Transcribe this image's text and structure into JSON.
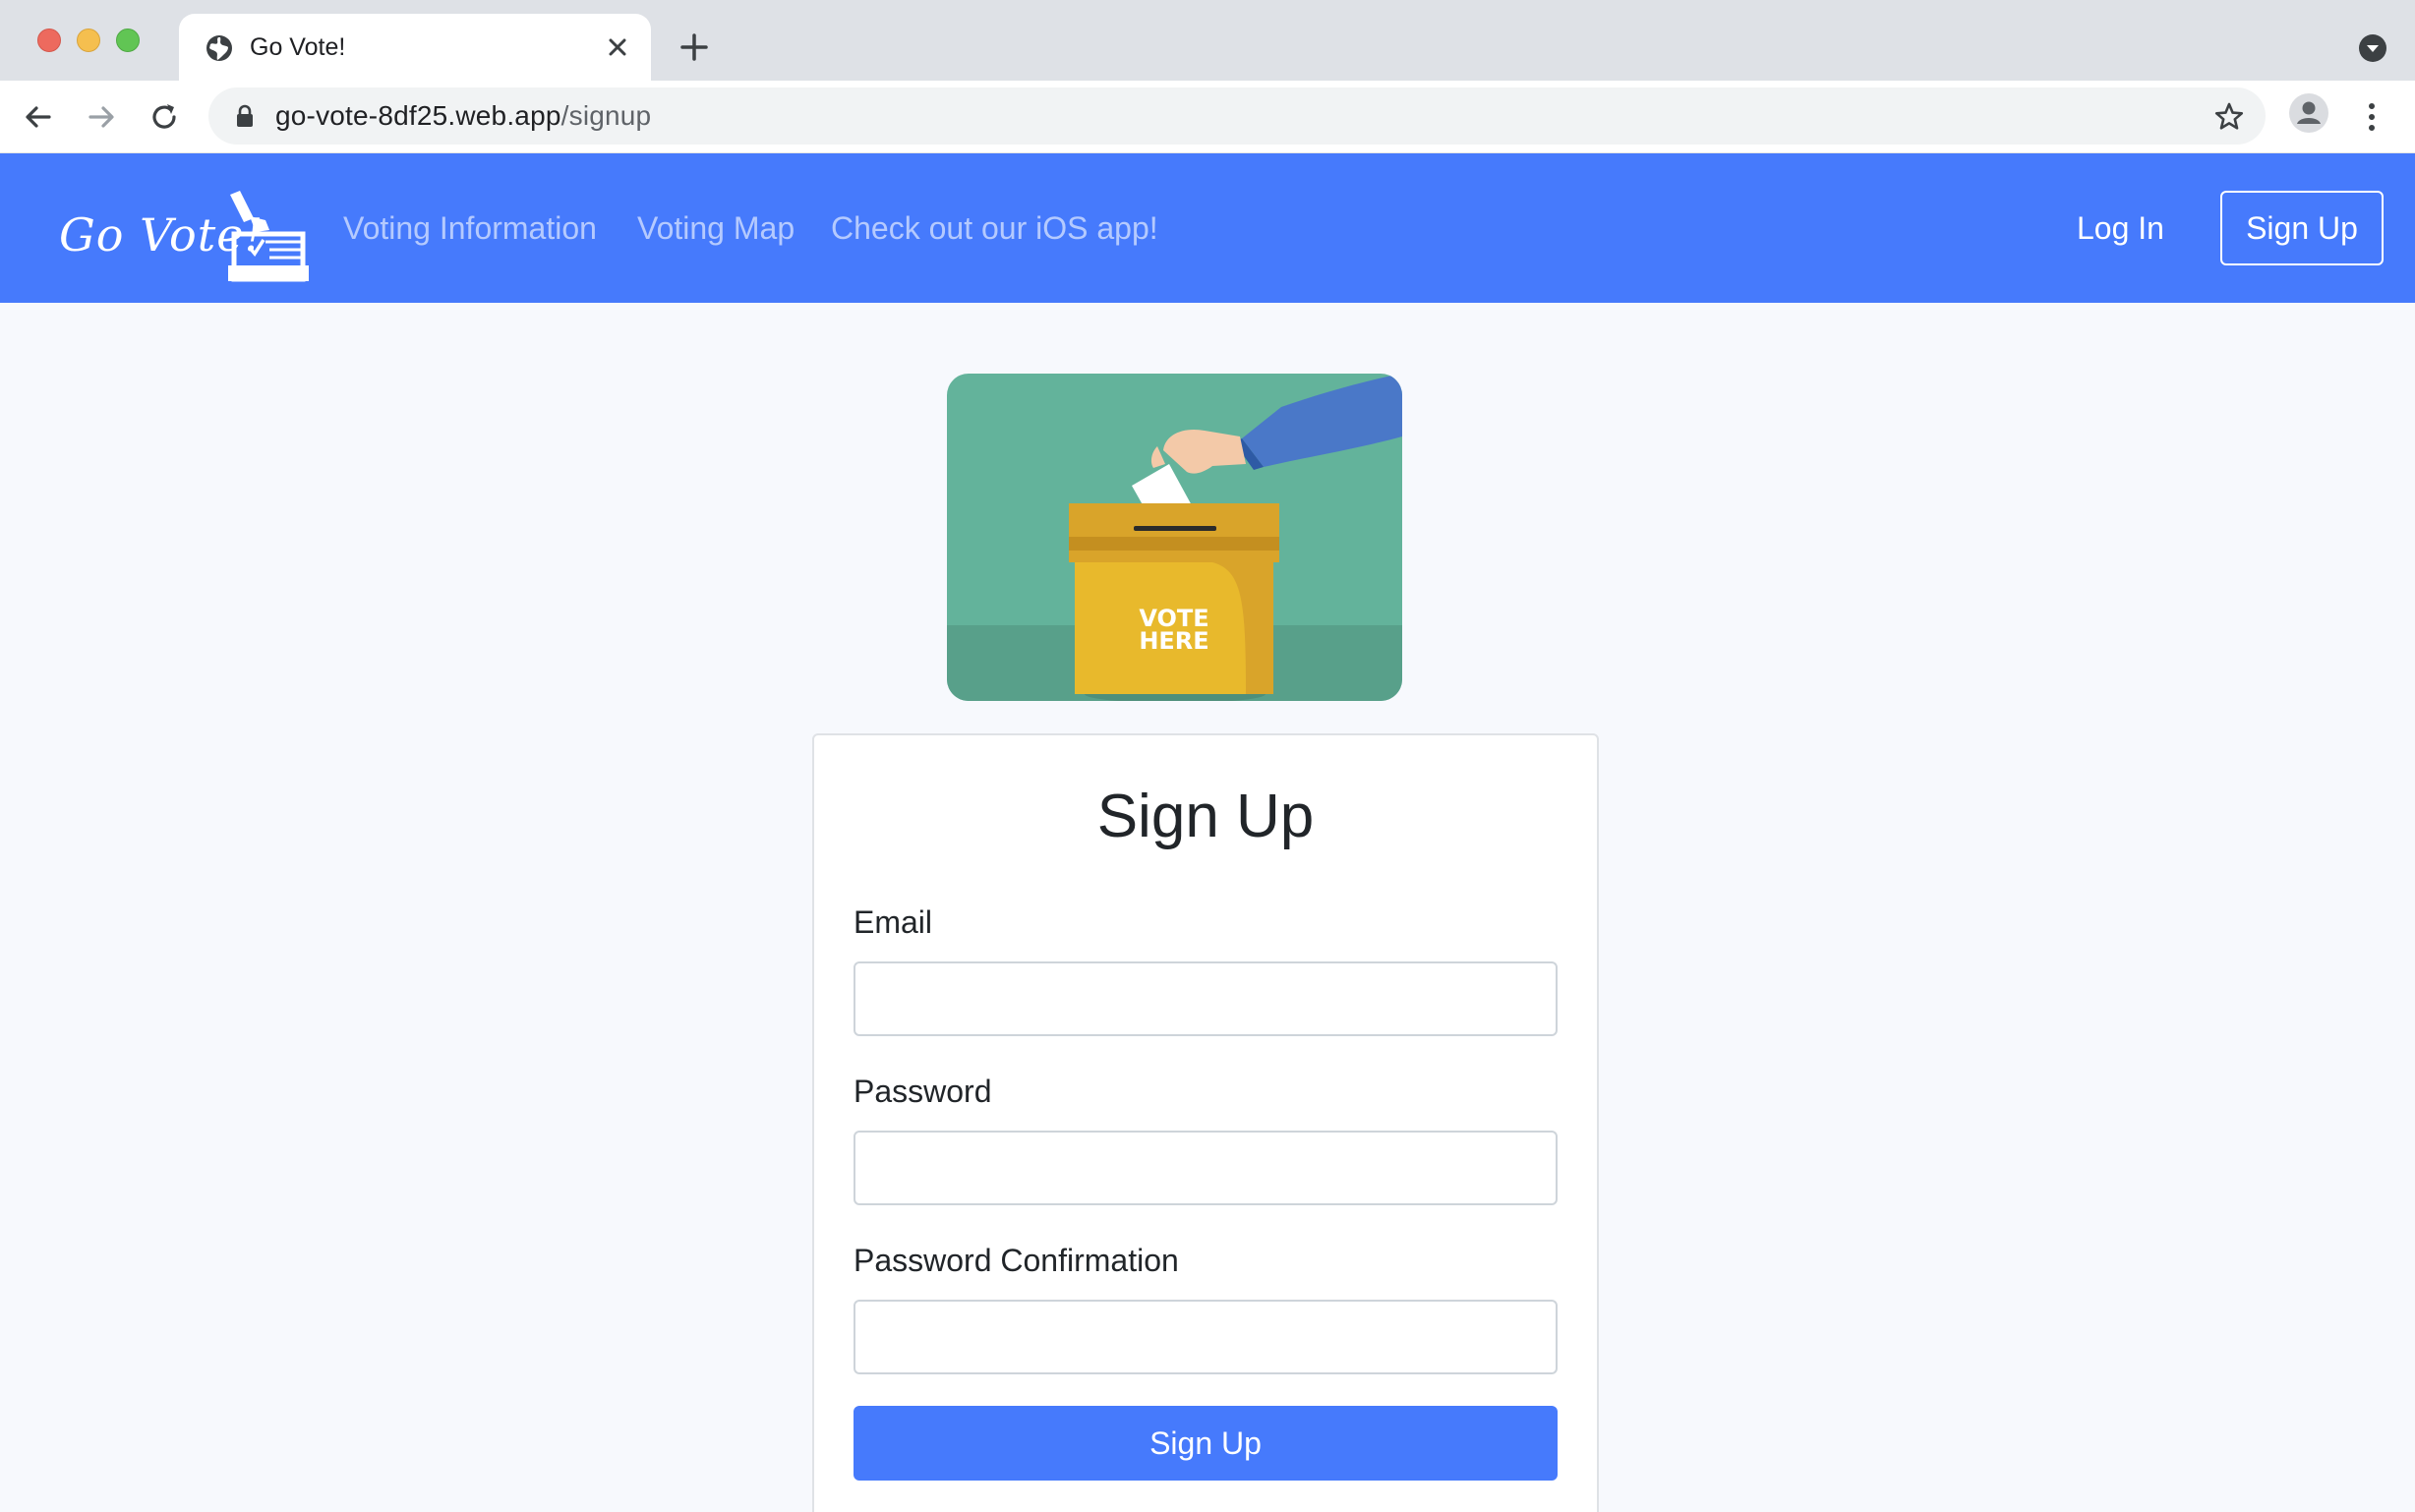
{
  "browser": {
    "tab_title": "Go Vote!",
    "url_host": "go-vote-8df25.web.app",
    "url_path": "/signup"
  },
  "navbar": {
    "brand": "Go Vote!",
    "links": [
      "Voting Information",
      "Voting Map",
      "Check out our iOS app!"
    ],
    "login_label": "Log In",
    "signup_label": "Sign Up",
    "color": "#467afc"
  },
  "hero": {
    "box_text_line1": "VOTE",
    "box_text_line2": "HERE"
  },
  "form": {
    "title": "Sign Up",
    "email_label": "Email",
    "email_value": "",
    "password_label": "Password",
    "password_value": "",
    "confirm_label": "Password Confirmation",
    "confirm_value": "",
    "submit_label": "Sign Up"
  }
}
